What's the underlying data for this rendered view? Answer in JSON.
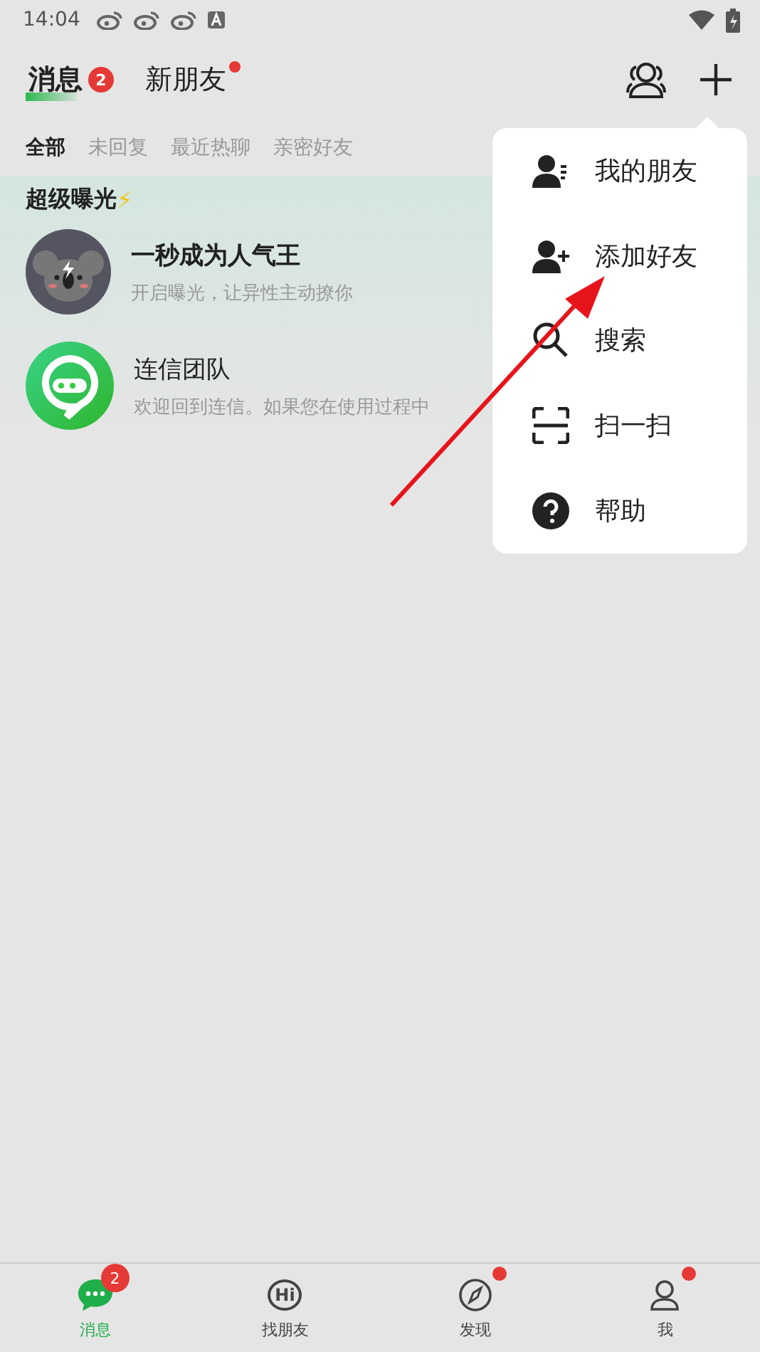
{
  "status_bar": {
    "time": "14:04"
  },
  "header": {
    "tabs": [
      {
        "label": "消息",
        "selected": true,
        "badge": "2",
        "dot": false
      },
      {
        "label": "新朋友",
        "selected": false,
        "dot": true
      }
    ]
  },
  "filters": [
    {
      "label": "全部",
      "selected": true
    },
    {
      "label": "未回复",
      "selected": false
    },
    {
      "label": "最近热聊",
      "selected": false
    },
    {
      "label": "亲密好友",
      "selected": false
    }
  ],
  "promo": {
    "title": "超级曝光",
    "icon": "⚡"
  },
  "chats": [
    {
      "kind": "koala",
      "name": "一秒成为人气王",
      "preview": "开启曝光，让异性主动撩你"
    },
    {
      "kind": "team",
      "name": "连信团队",
      "preview": "欢迎回到连信。如果您在使用过程中"
    }
  ],
  "menu": [
    {
      "kind": "friends",
      "label": "我的朋友"
    },
    {
      "kind": "add",
      "label": "添加好友"
    },
    {
      "kind": "search",
      "label": "搜索"
    },
    {
      "kind": "scan",
      "label": "扫一扫"
    },
    {
      "kind": "help",
      "label": "帮助"
    }
  ],
  "bottom_nav": [
    {
      "kind": "chat",
      "label": "消息",
      "selected": true,
      "badge": "2",
      "dot": false
    },
    {
      "kind": "hi",
      "label": "找朋友",
      "selected": false,
      "dot": false,
      "icon_text": "Hi"
    },
    {
      "kind": "compass",
      "label": "发现",
      "selected": false,
      "dot": true
    },
    {
      "kind": "me",
      "label": "我",
      "selected": false,
      "dot": true
    }
  ]
}
